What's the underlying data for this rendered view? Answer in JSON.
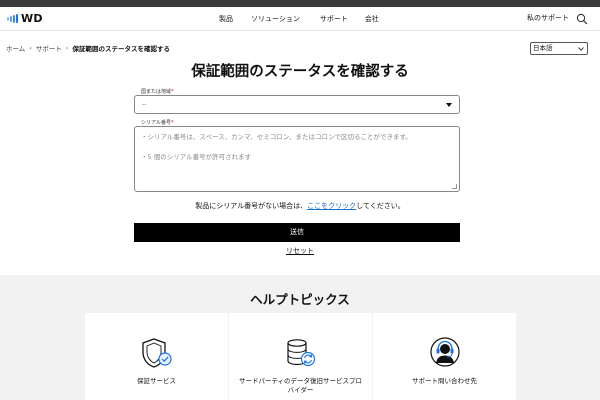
{
  "brand": {
    "logo_text": "WD",
    "accent": "#1a73e8"
  },
  "nav": {
    "items": [
      "製品",
      "ソリューション",
      "サポート",
      "会社"
    ],
    "my_support": "私のサポート"
  },
  "breadcrumb": {
    "items": [
      "ホーム",
      "サポート"
    ],
    "current": "保証範囲のステータスを確認する"
  },
  "language": {
    "selected": "日本語"
  },
  "page": {
    "title": "保証範囲のステータスを確認する"
  },
  "form": {
    "country_label": "国または地域",
    "country_required": "*",
    "country_value": "--",
    "serial_label": "シリアル番号",
    "serial_required": "*",
    "serial_placeholder_1": "・シリアル番号は、スペース、カンマ、セミコロン、またはコロンで区切ることができます。",
    "serial_placeholder_2": "・5 個のシリアル番号が許可されます",
    "no_serial_prefix": "製品にシリアル番号がない場合は、",
    "no_serial_link": "ここをクリック",
    "no_serial_suffix": "してください。",
    "submit_label": "送信",
    "reset_label": "リセット"
  },
  "help": {
    "title": "ヘルプトピックス",
    "cards": [
      {
        "label": "保証サービス",
        "icon": "shield-check-icon"
      },
      {
        "label": "サードパーティのデータ復旧サービスプロバイダー",
        "icon": "database-sync-icon"
      },
      {
        "label": "サポート問い合わせ先",
        "icon": "headset-agent-icon"
      }
    ]
  }
}
